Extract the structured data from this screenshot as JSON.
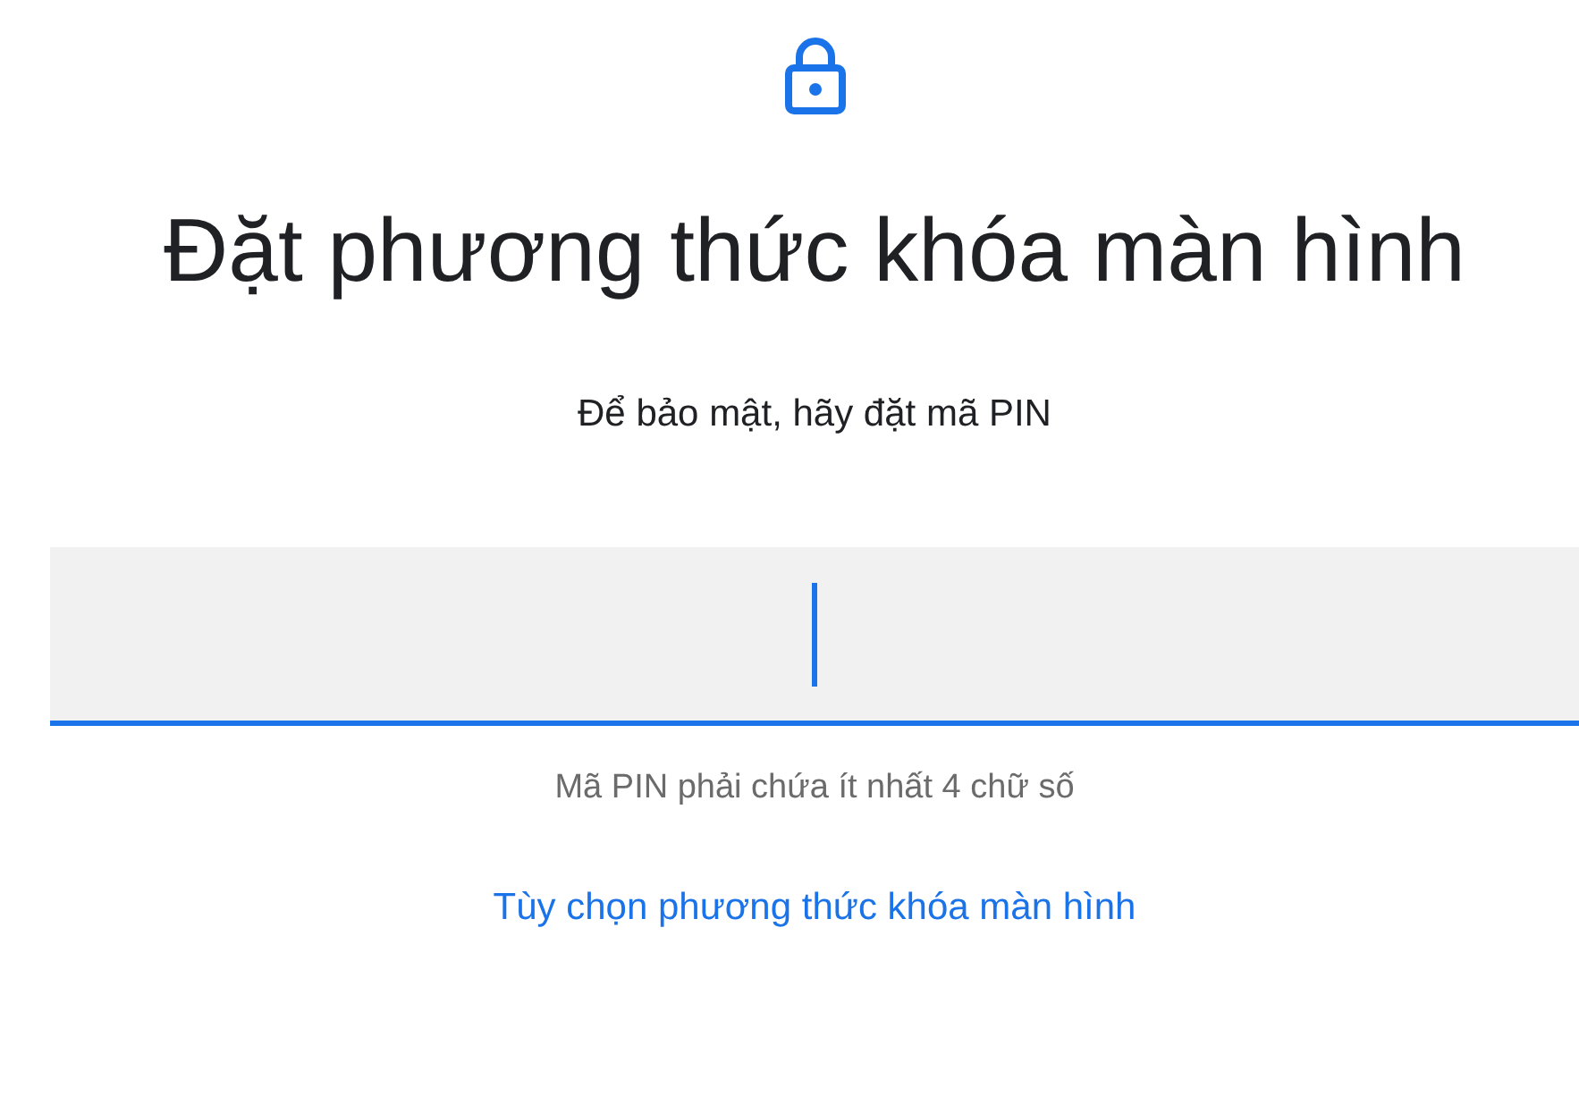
{
  "title": "Đặt phương thức khóa màn hình",
  "subtitle": "Để bảo mật, hãy đặt mã PIN",
  "pin_field": {
    "focused": true
  },
  "helper_text": "Mã PIN phải chứa ít nhất 4 chữ số",
  "link": "Tùy chọn phương thức khóa màn hình"
}
